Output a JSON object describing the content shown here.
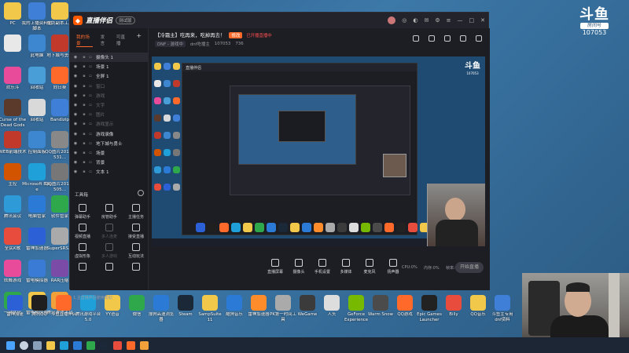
{
  "desktop_left": [
    {
      "label": "PC",
      "color": "#f2c84b"
    },
    {
      "label": "我的上播资料包脚本",
      "color": "#3f7fd8"
    },
    {
      "label": "魔剑副本工具",
      "color": "#f2c84b"
    },
    {
      "label": "",
      "color": "#e8e8e8"
    },
    {
      "label": "此电脑",
      "color": "#3d87d0"
    },
    {
      "label": "地下城与勇士",
      "color": "#c0392b"
    },
    {
      "label": "欢乐斗",
      "color": "#e84b9a"
    },
    {
      "label": "回收站",
      "color": "#4a9ed8"
    },
    {
      "label": "向日葵",
      "color": "#ff6a2b"
    },
    {
      "label": "Curse of the Dead Gods",
      "color": "#5b3a2b"
    },
    {
      "label": "回收站",
      "color": "#d9d9d9"
    },
    {
      "label": "Bandizip",
      "color": "#3f7fd8"
    },
    {
      "label": "WEB前端技术",
      "color": "#c0392b"
    },
    {
      "label": "控制面板",
      "color": "#3d87d0"
    },
    {
      "label": "QQ图片20180531...",
      "color": "#888"
    },
    {
      "label": "主控",
      "color": "#d35400"
    },
    {
      "label": "Microsoft Edge",
      "color": "#1fa0d8"
    },
    {
      "label": "QQ图片20170505...",
      "color": "#777"
    },
    {
      "label": "腾讯会议",
      "color": "#2e9bd8"
    },
    {
      "label": "电脑管家",
      "color": "#2b7bd6"
    },
    {
      "label": "软件管家",
      "color": "#2ea84b"
    },
    {
      "label": "全民K歌",
      "color": "#e74c3c"
    },
    {
      "label": "雷神加速器",
      "color": "#2b60d6"
    },
    {
      "label": "SuperSRS...",
      "color": "#aaa"
    },
    {
      "label": "炫舞游戏",
      "color": "#e84b9a"
    },
    {
      "label": "雷电模拟器",
      "color": "#3a7bd5"
    },
    {
      "label": "RAR压缩",
      "color": "#7b4ba8"
    },
    {
      "label": "一键优化",
      "color": "#2ea84b"
    },
    {
      "label": "雷电模拟器",
      "color": "#f2c84b"
    },
    {
      "label": "腾讯游戏平台",
      "color": "#f2a13a"
    },
    {
      "label": "",
      "color": "#e8e8e8"
    }
  ],
  "desktop_bottom": [
    {
      "label": "雷神加速",
      "color": "#2b60d6"
    },
    {
      "label": "腾讯QQ",
      "color": "#1f1f1f"
    },
    {
      "label": "斗鱼直播伴侣",
      "color": "#ff6a2b"
    },
    {
      "label": "腾讯游戏平台5.0",
      "color": "#1fa0d8"
    },
    {
      "label": "YY语音",
      "color": "#f2c84b"
    },
    {
      "label": "微信",
      "color": "#2ea84b"
    },
    {
      "label": "搜狗高速浏览器",
      "color": "#2b7bd6"
    },
    {
      "label": "Steam",
      "color": "#1b2838"
    },
    {
      "label": "SampSuite 11",
      "color": "#f2c84b"
    },
    {
      "label": "酷狗音乐",
      "color": "#2b7bd6"
    },
    {
      "label": "雷神加速器",
      "color": "#ff8c2b"
    },
    {
      "label": "PK第一时间工具",
      "color": "#aaa"
    },
    {
      "label": "WeGame",
      "color": "#3b3b3b"
    },
    {
      "label": "人头",
      "color": "#ddd"
    },
    {
      "label": "GeForce Experience",
      "color": "#76b900"
    },
    {
      "label": "Warm Snow",
      "color": "#4b4b4b"
    },
    {
      "label": "QQ游戏",
      "color": "#ff6a2b"
    },
    {
      "label": "Epic Games Launcher",
      "color": "#222"
    },
    {
      "label": "Billy",
      "color": "#e74c3c"
    },
    {
      "label": "QQ音乐",
      "color": "#f2c84b"
    },
    {
      "label": "斗鱼主专用dnf资料",
      "color": "#3f7fd8"
    }
  ],
  "app": {
    "brand": "直播伴侣",
    "version": "测试版",
    "title_icons": [
      "minimize",
      "maximize",
      "close"
    ],
    "tabs": [
      "我的场景",
      "发言",
      "可直播"
    ],
    "scenes": [
      {
        "name": "摄像头 1",
        "sel": true,
        "dim": false
      },
      {
        "name": "场景 1",
        "sel": false,
        "dim": false
      },
      {
        "name": "全屏 1",
        "sel": false,
        "dim": false
      },
      {
        "name": "窗口",
        "sel": false,
        "dim": true
      },
      {
        "name": "游戏",
        "sel": false,
        "dim": true
      },
      {
        "name": "文字",
        "sel": false,
        "dim": true
      },
      {
        "name": "图片",
        "sel": false,
        "dim": true
      },
      {
        "name": "游戏显示",
        "sel": false,
        "dim": true
      },
      {
        "name": "游戏录像",
        "sel": false,
        "dim": false
      },
      {
        "name": "地下城与勇士",
        "sel": false,
        "dim": false
      },
      {
        "name": "场景",
        "sel": false,
        "dim": false
      },
      {
        "name": "背景",
        "sel": false,
        "dim": false
      },
      {
        "name": "文本 1",
        "sel": false,
        "dim": false
      }
    ],
    "tools_title": "工具箱",
    "tools": [
      {
        "label": "弹幕助手",
        "dim": false
      },
      {
        "label": "房管助手",
        "dim": false
      },
      {
        "label": "主播任务",
        "dim": false
      },
      {
        "label": "视频直播",
        "dim": false
      },
      {
        "label": "多人连麦",
        "dim": true
      },
      {
        "label": "接受直播",
        "dim": false
      },
      {
        "label": "虚拟形象",
        "dim": false
      },
      {
        "label": "多人游戏",
        "dim": true
      },
      {
        "label": "互动玩法",
        "dim": false
      },
      {
        "label": "",
        "dim": false
      },
      {
        "label": "",
        "dim": false
      },
      {
        "label": "",
        "dim": false
      }
    ],
    "sidebar_footer": "1.主直播伴侣使用帮助",
    "room_title": "【冷霜主】吃再来，吃掉再去！",
    "room_badge": "修改",
    "room_hot": "已开播直播中",
    "room_category": "DNF - 游戏中",
    "room_user": "dnf吃播主",
    "room_id": "107053",
    "room_viewers": "736",
    "controls": [
      {
        "label": "直播屏幕"
      },
      {
        "label": "摄像头"
      },
      {
        "label": "手机设置"
      },
      {
        "label": "多媒体"
      },
      {
        "label": "麦克风"
      },
      {
        "label": "扬声器"
      }
    ],
    "stats": [
      "CPU:0%",
      "内存:0%",
      "帧率:0"
    ],
    "go_live": "开始直播"
  },
  "watermark": {
    "logo": "斗鱼",
    "sub": "房间号",
    "room": "107053"
  }
}
